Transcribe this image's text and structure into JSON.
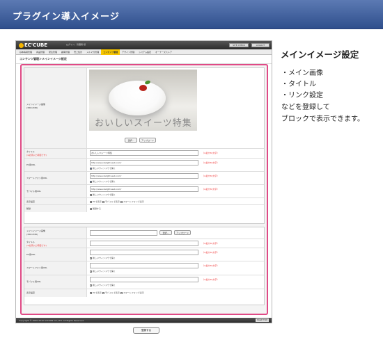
{
  "header": {
    "title": "プラグイン導入イメージ"
  },
  "app": {
    "logo": "EC'CUBE",
    "user": "ログイン：管理者 様",
    "site_btn": "SITE CHECK",
    "logout_btn": "LOGOUT"
  },
  "nav": [
    "基本情報管理",
    "商品管理",
    "受注管理",
    "顧客管理",
    "売上集計",
    "メルマガ管理",
    "コンテンツ管理",
    "デザイン管理",
    "システム設定",
    "オーナーズストア"
  ],
  "breadcrumb": "コンテンツ管理＞メインイメージ設定",
  "section1": {
    "image_label": "メインイメージ画像",
    "image_size": "(380×380)",
    "photo_text": "おいしいスイーツ特集",
    "select_btn": "選択...",
    "upload_btn": "アップロード",
    "title_label": "タイトル",
    "title_note": "(※必須入力項目です)",
    "title_value": "おいしいスイーツ特集",
    "pc_label": "PC用URL",
    "sp_label": "スマートフォン用URL",
    "mb_label": "モバイル用URL",
    "url_value": "http://www.delight-web.com/",
    "new_window": "新しいウィンドウで開く",
    "req": "（※最大50文字）",
    "display_label": "表示設定",
    "display_options": [
      "PCで表示",
      "モバイルで表示",
      "スマートフォンで表示"
    ],
    "delete_label": "削除",
    "delete_option": "削除する"
  },
  "section2": {
    "image_label": "メインイメージ画像",
    "image_size": "(380×380)",
    "select_btn": "選択...",
    "upload_btn": "アップロード",
    "title_label": "タイトル",
    "title_note": "(※必須入力項目です)",
    "pc_label": "PC用URL",
    "sp_label": "スマートフォン用URL",
    "mb_label": "モバイル用URL",
    "new_window": "新しいウィンドウで開く",
    "req": "（※最大50文字）",
    "display_label": "表示設定",
    "display_options": [
      "PCで表示",
      "モバイルで表示",
      "スマートフォンで表示"
    ]
  },
  "register_btn": "登録する",
  "footer": {
    "copyright": "Copyright © 2000-2010 LOCKON CO.,LTD. All Rights Reserved.",
    "page_top": "PAGE TOP"
  },
  "side": {
    "title": "メインイメージ設定",
    "items": [
      "・メイン画像",
      "・タイトル",
      "・リンク設定",
      "などを登録して",
      "ブロックで表示できます。"
    ]
  }
}
